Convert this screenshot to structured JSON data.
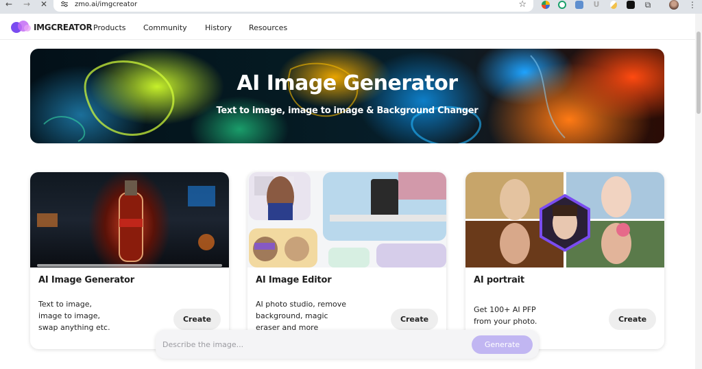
{
  "browser": {
    "url": "zmo.ai/imgcreator",
    "back_icon": "arrow-left",
    "forward_icon": "arrow-right",
    "stop_icon": "close",
    "star_icon": "star",
    "menu_icon": "kebab"
  },
  "site": {
    "brand": "IMGCREATOR",
    "nav": [
      "Products",
      "Community",
      "History",
      "Resources"
    ]
  },
  "hero": {
    "title": "AI Image Generator",
    "subtitle": "Text to image, image to image & Background Changer"
  },
  "cards": [
    {
      "title": "AI Image Generator",
      "desc_lines": [
        "Text to image,",
        "image to image,",
        "swap anything etc."
      ],
      "button": "Create"
    },
    {
      "title": "AI Image Editor",
      "desc_lines": [
        "AI photo studio, remove",
        "background, magic",
        "eraser and more"
      ],
      "button": "Create"
    },
    {
      "title": "AI portrait",
      "desc_lines": [
        "Get 100+ AI PFP",
        "from your photo."
      ],
      "button": "Create"
    }
  ],
  "prompt": {
    "placeholder": "Describe the image...",
    "value": "",
    "button": "Generate"
  },
  "colors": {
    "accent": "#c1b6f2",
    "chrome": "#dfe3e8"
  }
}
